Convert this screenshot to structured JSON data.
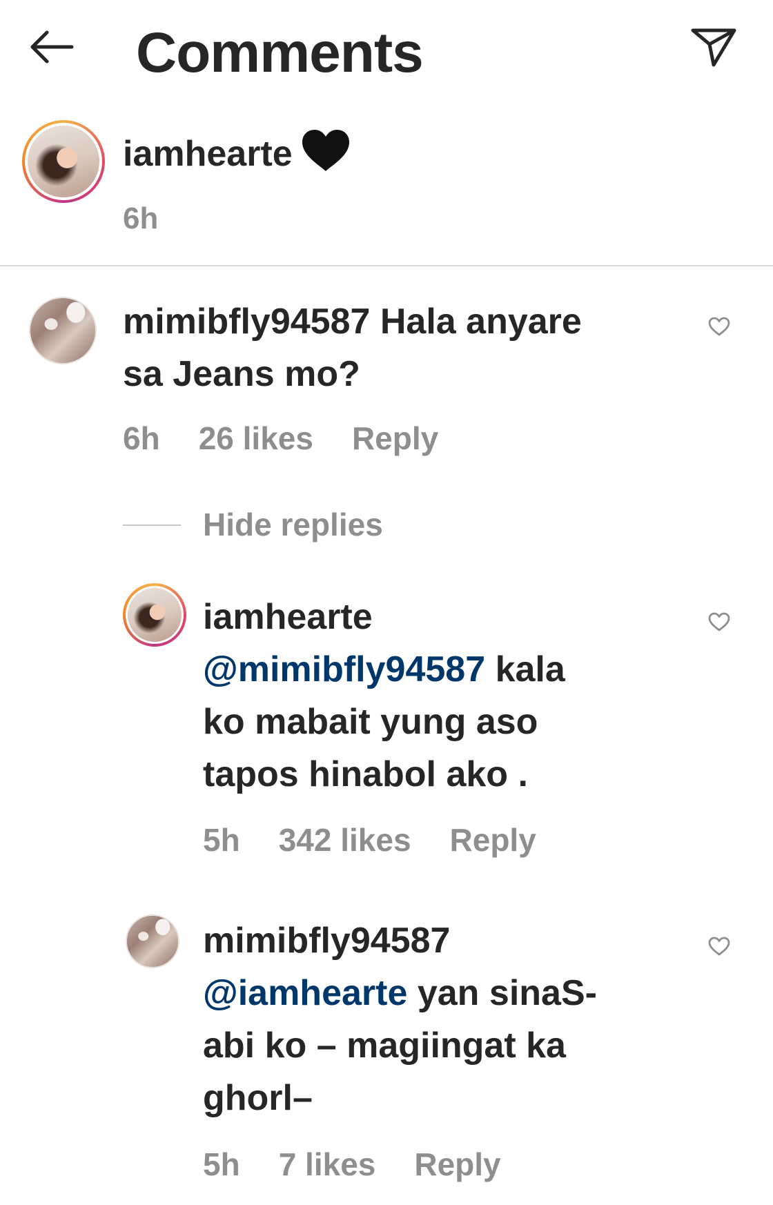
{
  "header": {
    "title": "Comments",
    "back_icon": "arrow-left-icon",
    "share_icon": "paper-plane-icon"
  },
  "caption": {
    "username": "iamhearte",
    "emoji": "black-heart",
    "time": "6h"
  },
  "comments": [
    {
      "username": "mimibfly94587",
      "text_line1": "Hala anyare",
      "text_line2": "sa Jeans mo?",
      "time": "6h",
      "likes": "26 likes",
      "reply": "Reply"
    }
  ],
  "hide_replies": "Hide replies",
  "replies": [
    {
      "username": "iamhearte",
      "mention": "@mimibfly94587",
      "text_line1": "kala",
      "text_line2": "ko mabait yung aso",
      "text_line3": "tapos hinabol ako .",
      "time": "5h",
      "likes": "342 likes",
      "reply": "Reply"
    },
    {
      "username": "mimibfly94587",
      "mention": "@iamhearte",
      "text_line1": "yan sinaS-",
      "text_line2": "abi ko – magiingat ka",
      "text_line3": "ghorl–",
      "time": "5h",
      "likes": "7 likes",
      "reply": "Reply"
    }
  ],
  "colors": {
    "text": "#262626",
    "muted": "#8e8e8e",
    "mention": "#00376b",
    "divider": "#dbdbdb"
  }
}
